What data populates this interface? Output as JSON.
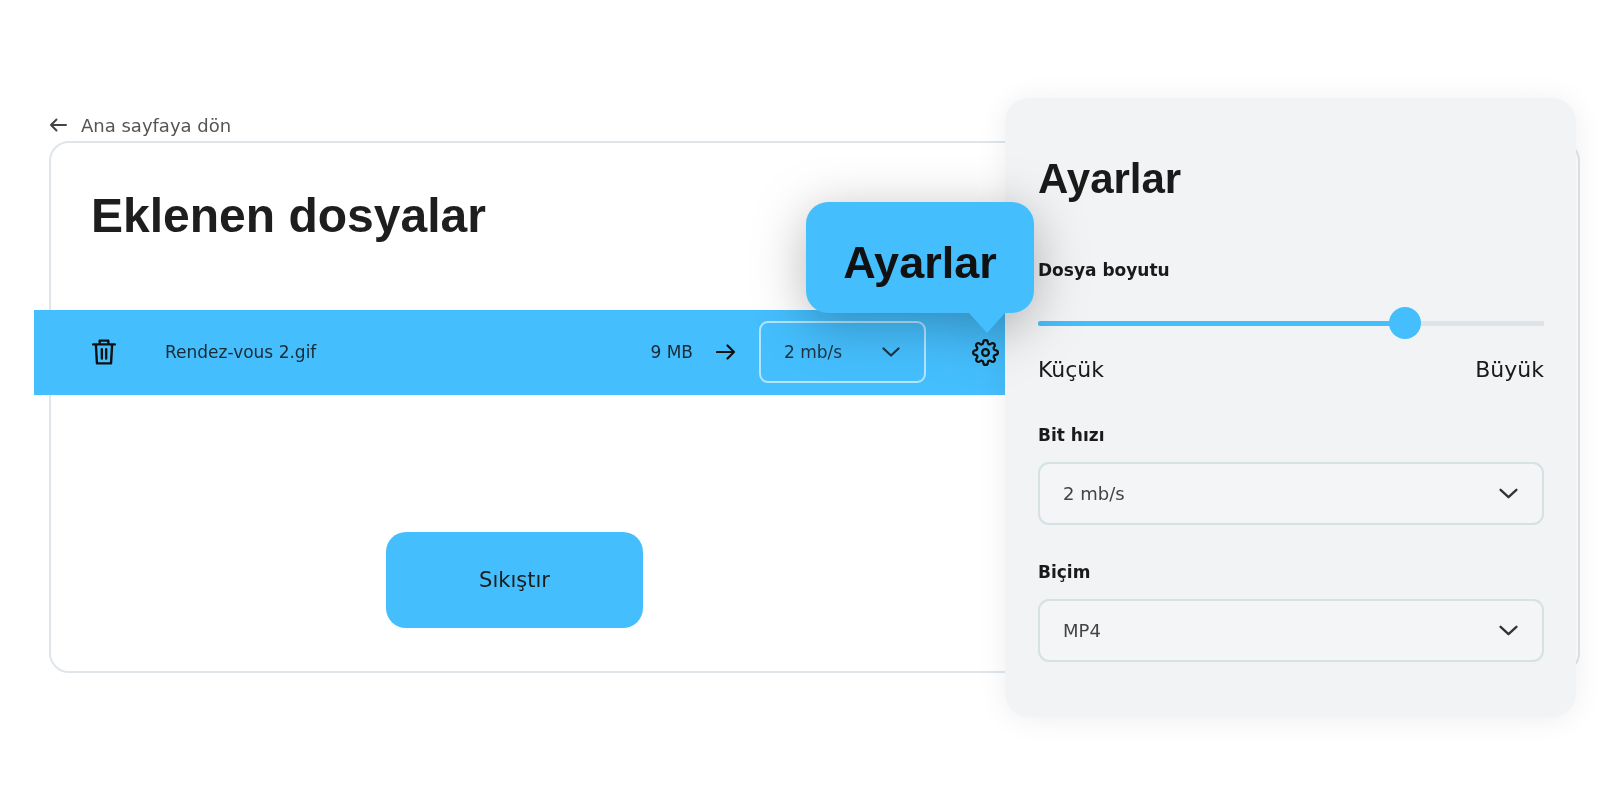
{
  "back_link": {
    "label": "Ana sayfaya dön"
  },
  "files_panel": {
    "title": "Eklenen dosyalar",
    "files": [
      {
        "name": "Rendez-vous 2.gif",
        "size": "9 MB",
        "bitrate": "2 mb/s",
        "selected": true
      }
    ],
    "compress_button": "Sıkıştır"
  },
  "tooltip": {
    "text": "Ayarlar"
  },
  "settings": {
    "title": "Ayarlar",
    "size_slider": {
      "label": "Dosya boyutu",
      "level": 0.725,
      "min_label": "Küçük",
      "max_label": "Büyük"
    },
    "bitrate": {
      "label": "Bit hızı",
      "value": "2 mb/s"
    },
    "format": {
      "label": "Biçim",
      "value": "MP4"
    }
  }
}
